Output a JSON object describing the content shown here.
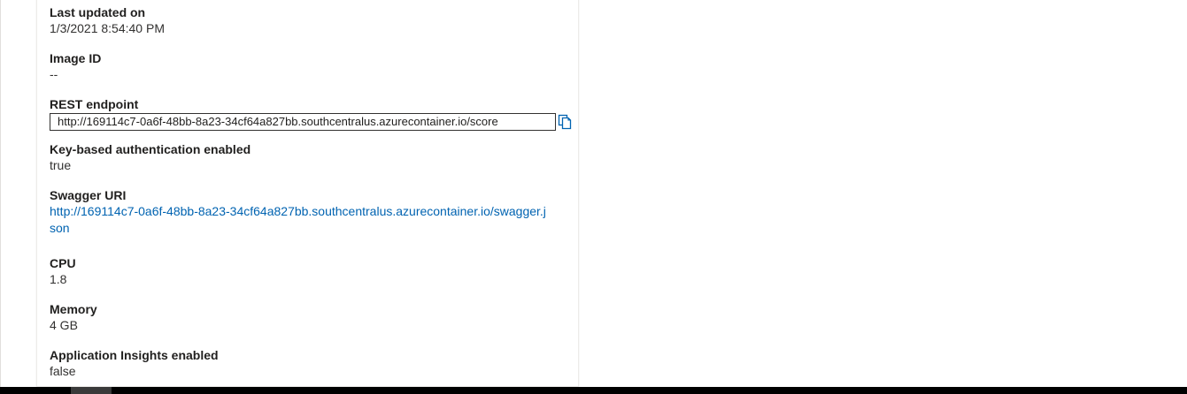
{
  "properties": {
    "last_updated": {
      "label": "Last updated on",
      "value": "1/3/2021 8:54:40 PM"
    },
    "image_id": {
      "label": "Image ID",
      "value": "--"
    },
    "rest_endpoint": {
      "label": "REST endpoint",
      "value": "http://169114c7-0a6f-48bb-8a23-34cf64a827bb.southcentralus.azurecontainer.io/score"
    },
    "key_auth": {
      "label": "Key-based authentication enabled",
      "value": "true"
    },
    "swagger_uri": {
      "label": "Swagger URI",
      "value": "http://169114c7-0a6f-48bb-8a23-34cf64a827bb.southcentralus.azurecontainer.io/swagger.json"
    },
    "cpu": {
      "label": "CPU",
      "value": "1.8"
    },
    "memory": {
      "label": "Memory",
      "value": "4 GB"
    },
    "app_insights": {
      "label": "Application Insights enabled",
      "value": "false"
    }
  },
  "icons": {
    "copy": "copy-icon"
  },
  "colors": {
    "link": "#0063b1",
    "text": "#323130",
    "label": "#201f1e"
  }
}
